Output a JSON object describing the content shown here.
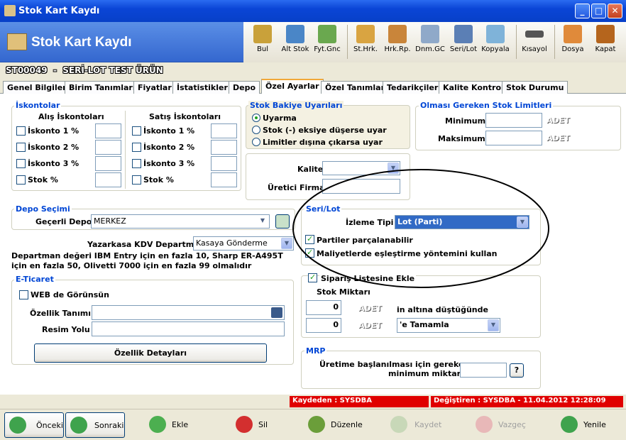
{
  "window": {
    "title": "Stok Kart Kaydı",
    "header_title": "Stok Kart Kaydı"
  },
  "toolbar": [
    {
      "label": "Bul",
      "icon": "binoculars-icon",
      "color": "#c9a13a"
    },
    {
      "label": "Alt Stok",
      "icon": "network-icon",
      "color": "#4a86c7"
    },
    {
      "label": "Fyt.Gnc",
      "icon": "coins-icon",
      "color": "#6aa84f"
    },
    {
      "label": "St.Hrk.",
      "icon": "stock-movement-icon",
      "color": "#d9a441"
    },
    {
      "label": "Hrk.Rp.",
      "icon": "report-icon",
      "color": "#c9853a"
    },
    {
      "label": "Dnm.GC",
      "icon": "period-icon",
      "color": "#8fa9c9"
    },
    {
      "label": "Seri/Lot",
      "icon": "serial-lot-icon",
      "color": "#5b7fb5"
    },
    {
      "label": "Kopyala",
      "icon": "copy-icon",
      "color": "#7fb3d9"
    },
    {
      "label": "Kısayol",
      "icon": "keyboard-icon",
      "color": "#555555"
    },
    {
      "label": "Dosya",
      "icon": "folder-icon",
      "color": "#e08a3a"
    },
    {
      "label": "Kapat",
      "icon": "door-exit-icon",
      "color": "#b5651d"
    }
  ],
  "record": {
    "code": "ST00049",
    "sep": "-",
    "name": "SERİ-LOT TEST ÜRÜN"
  },
  "tabs": [
    "Genel Bilgiler",
    "Birim Tanımları",
    "Fiyatlar",
    "İstatistikler",
    "Depo",
    "Özel Ayarlar",
    "Özel Tanımlar",
    "Tedarikçiler",
    "Kalite Kontrol",
    "Stok Durumu"
  ],
  "active_tab": "Özel Ayarlar",
  "iskontolar": {
    "title": "İskontolar",
    "alis_header": "Alış İskontoları",
    "satis_header": "Satış İskontoları",
    "items": [
      "İskonto 1 %",
      "İskonto 2 %",
      "İskonto 3 %",
      "Stok %"
    ]
  },
  "bakiye": {
    "title": "Stok Bakiye Uyarıları",
    "options": [
      "Uyarma",
      "Stok (-) eksiye düşerse uyar",
      "Limitler dışına çıkarsa uyar"
    ],
    "selected": 0
  },
  "limitler": {
    "title": "Olması Gereken Stok Limitleri",
    "min_label": "Minimum",
    "max_label": "Maksimum",
    "unit": "ADET"
  },
  "kalite": {
    "label": "Kalite",
    "uretici_label": "Üretici Firma"
  },
  "depo": {
    "title": "Depo Seçimi",
    "label": "Geçerli Depo",
    "value": "MERKEZ"
  },
  "kdv": {
    "label": "Yazarkasa KDV Departmanı",
    "value": "Kasaya Gönderme",
    "note": "Departman değeri IBM Entry için en fazla 10, Sharp ER-A495T için en fazla 50, Olivetti 7000 için en fazla 99 olmalıdır"
  },
  "seri_lot": {
    "title": "Seri/Lot",
    "izleme_label": "İzleme Tipi",
    "izleme_value": "Lot (Parti)",
    "partiler": "Partiler parçalanabilir",
    "maliyet": "Maliyetlerde eşleştirme yöntemini kullan"
  },
  "siparis": {
    "check_label": "Sipariş Listesine Ekle",
    "stok_miktari": "Stok Miktarı",
    "qty1": "0",
    "qty2": "0",
    "unit": "ADET",
    "altina": "in altına düştüğünde",
    "tamamla": "'e Tamamla"
  },
  "eticaret": {
    "title": "E-Ticaret",
    "web": "WEB de Görünsün",
    "ozellik_label": "Özellik Tanımı",
    "resim_label": "Resim Yolu",
    "detay_button": "Özellik Detayları"
  },
  "mrp": {
    "title": "MRP",
    "text1": "Üretime başlanılması için gereken",
    "text2": "minimum miktar",
    "help": "?"
  },
  "status": {
    "kaydeden": "Kaydeden : SYSDBA",
    "degistiren": "Değiştiren : SYSDBA - 11.04.2012 12:28:09"
  },
  "buttons": {
    "onceki": "Önceki",
    "sonraki": "Sonraki",
    "ekle": "Ekle",
    "sil": "Sil",
    "duzenle": "Düzenle",
    "kaydet": "Kaydet",
    "vazgec": "Vazgeç",
    "yenile": "Yenile"
  },
  "colors": {
    "title_bar": "#0a45d6",
    "group_title": "#0046d5",
    "status_red": "#e00000",
    "check_green": "#21a121",
    "selection": "#316ac5"
  }
}
